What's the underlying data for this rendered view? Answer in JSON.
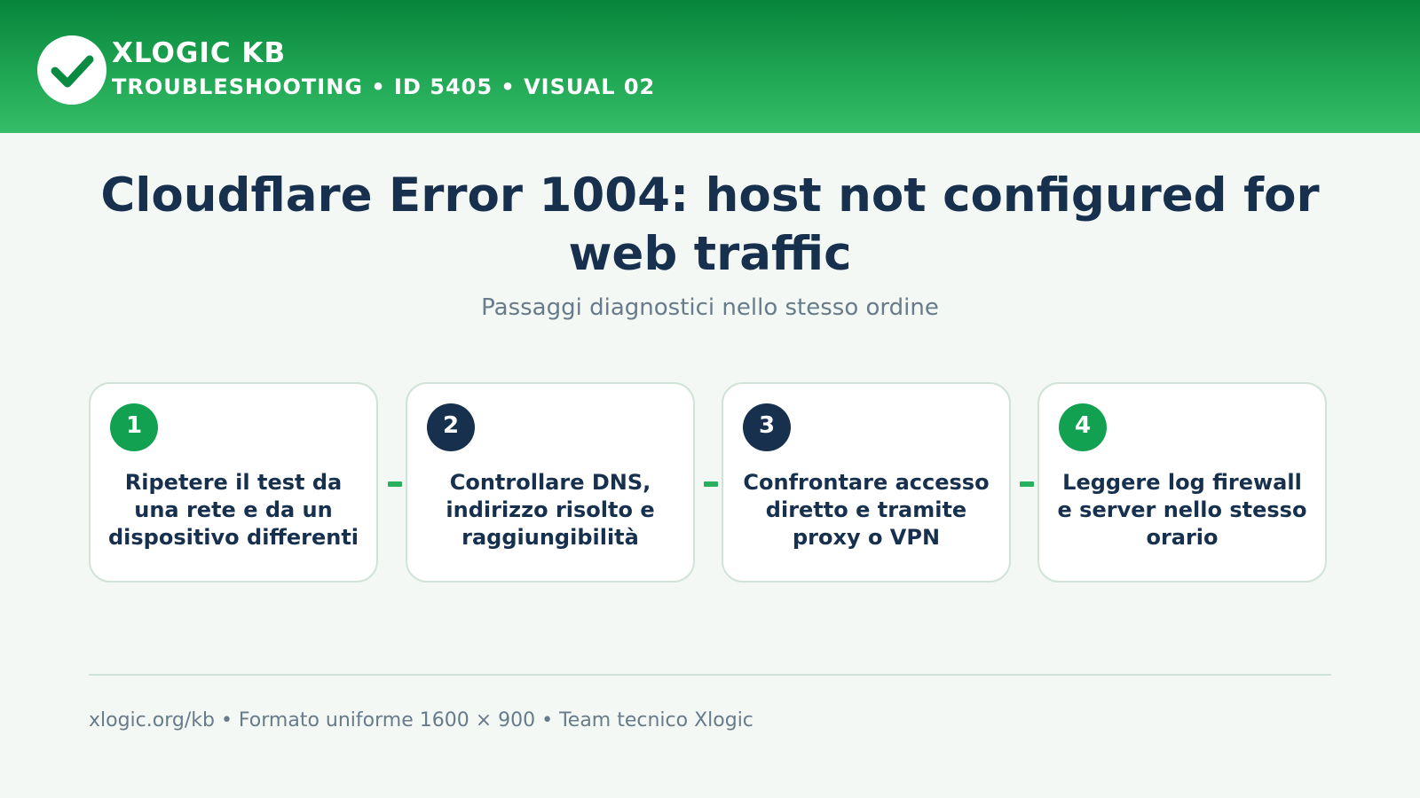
{
  "header": {
    "brand": "XLOGIC KB",
    "subtitle": "TROUBLESHOOTING • ID 5405 • VISUAL 02",
    "logo_icon": "check-icon",
    "color_top": "#07853b",
    "color_bottom": "#35bd67"
  },
  "main": {
    "title": "Cloudflare Error 1004: host not configured for web traffic",
    "subtitle": "Passaggi diagnostici nello stesso ordine"
  },
  "steps": [
    {
      "number": "1",
      "text": "Ripetere il test da una rete e da un dispositivo differenti",
      "badge_color": "#12a150"
    },
    {
      "number": "2",
      "text": "Controllare DNS, indirizzo risolto e raggiungibilità",
      "badge_color": "#17304d"
    },
    {
      "number": "3",
      "text": "Confrontare accesso diretto e tramite proxy o VPN",
      "badge_color": "#17304d"
    },
    {
      "number": "4",
      "text": "Leggere log firewall e server nello stesso orario",
      "badge_color": "#12a150"
    }
  ],
  "colors": {
    "accent": "#28b05f",
    "navy": "#17304d",
    "background": "#f3f8f5"
  },
  "footer": {
    "text": "xlogic.org/kb • Formato uniforme 1600 × 900 • Team tecnico Xlogic"
  }
}
